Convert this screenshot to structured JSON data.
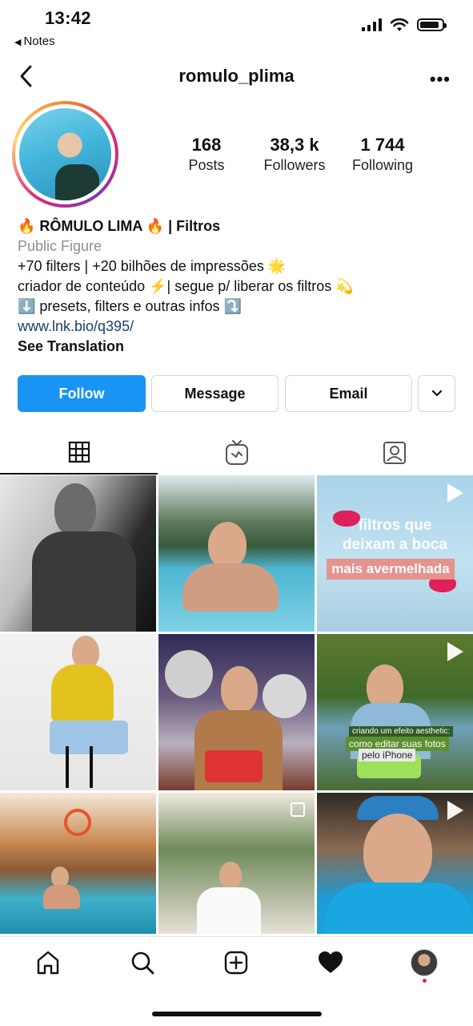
{
  "status_bar": {
    "time": "13:42",
    "back_app": "Notes",
    "battery_level": 0.9
  },
  "header": {
    "username": "romulo_plima"
  },
  "profile": {
    "stats": [
      {
        "value": "168",
        "label": "Posts"
      },
      {
        "value": "38,3 k",
        "label": "Followers"
      },
      {
        "value": "1 744",
        "label": "Following"
      }
    ],
    "bio": {
      "name": "🔥 RÔMULO LIMA 🔥 | Filtros",
      "category": "Public Figure",
      "lines": [
        "+70 filters | +20 bilhões de impressões 🌟",
        "criador de conteúdo ⚡️| segue p/ liberar os filtros 💫",
        "⬇️ presets, filters e outras infos ⤵️"
      ],
      "link": "www.lnk.bio/q395/",
      "see_translation": "See Translation"
    }
  },
  "actions": {
    "follow": "Follow",
    "message": "Message",
    "email": "Email"
  },
  "tabs": [
    "grid-icon",
    "igtv-icon",
    "tagged-icon"
  ],
  "grid": {
    "tile3_caption_1": "filtros que",
    "tile3_caption_2": "deixam a boca",
    "tile3_caption_3": "mais avermelhada",
    "tile6_caption_1": "criando um efeito aesthetic:",
    "tile6_caption_2": "como editar suas fotos",
    "tile6_caption_3": "pelo iPhone"
  },
  "bottom_nav": [
    "home-icon",
    "search-icon",
    "new-post-icon",
    "activity-icon",
    "profile-avatar"
  ],
  "colors": {
    "follow_button": "#1a94f4",
    "link": "#1a3f6b",
    "secondary_text": "#8e8e8e"
  }
}
